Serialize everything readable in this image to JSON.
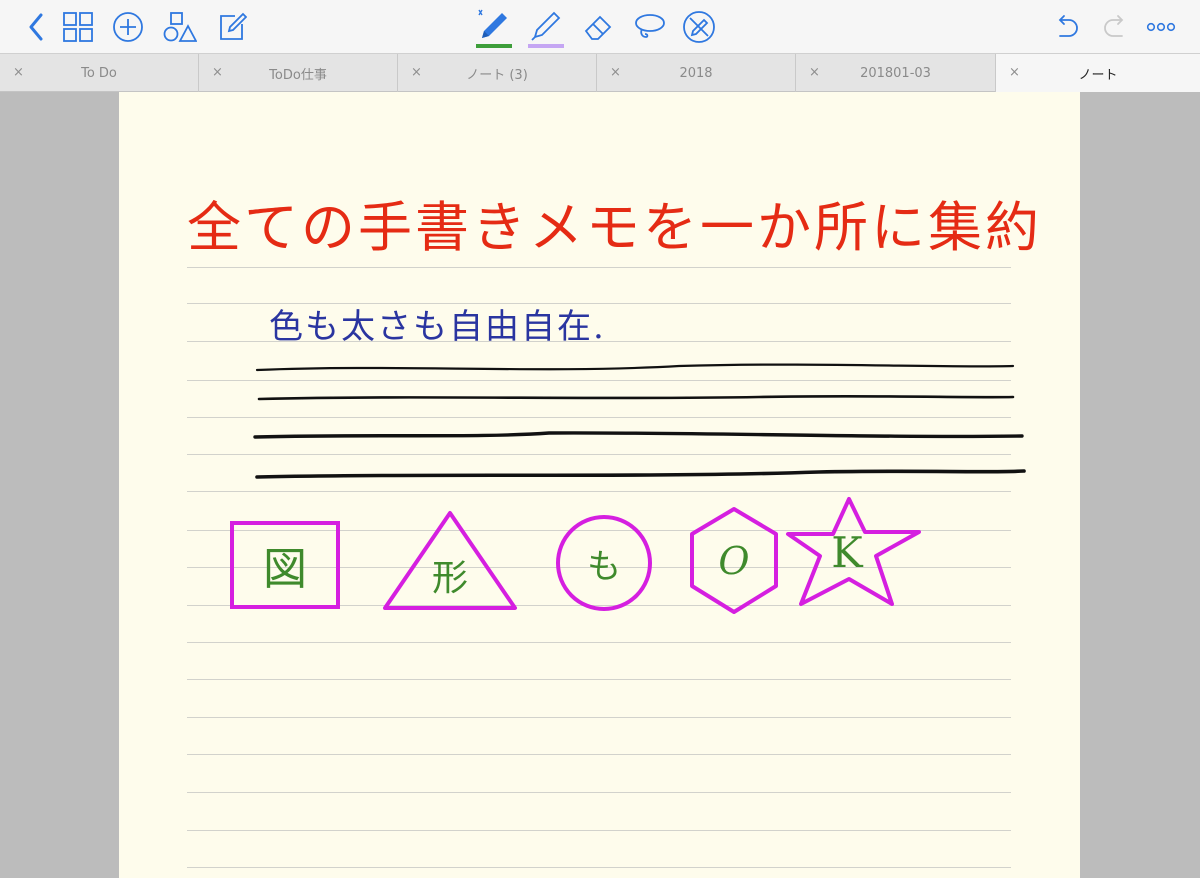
{
  "toolbar": {
    "left_icons": [
      "back-chevron-icon",
      "grid-icon",
      "add-circle-icon",
      "shapes-icon",
      "compose-icon"
    ],
    "center_tools": [
      "pen-tool-icon",
      "highlighter-icon",
      "eraser-icon",
      "lasso-icon",
      "disable-pen-icon"
    ],
    "right_icons": [
      "undo-icon",
      "redo-icon",
      "more-icon"
    ],
    "pen_color": "#3d9e3a",
    "highlighter_color": "#c5a6f3",
    "accent": "#2f78e0"
  },
  "tabs": [
    {
      "label": "To Do",
      "active": false
    },
    {
      "label": "ToDo仕事",
      "active": false
    },
    {
      "label": "ノート (3)",
      "active": false
    },
    {
      "label": "2018",
      "active": false
    },
    {
      "label": "201801-03",
      "active": false
    },
    {
      "label": "ノート",
      "active": true
    }
  ],
  "note": {
    "heading": "全ての手書きメモを一か所に集約",
    "subheading": "色も太さも自由自在.",
    "shapes": [
      {
        "shape": "square",
        "text": "図"
      },
      {
        "shape": "triangle",
        "text": "形"
      },
      {
        "shape": "circle",
        "text": "も"
      },
      {
        "shape": "hexagon",
        "text": "O"
      },
      {
        "shape": "star",
        "text": "K"
      }
    ],
    "colors": {
      "heading": "#e52b14",
      "subheading": "#2a35a0",
      "shape_outline": "#d51fe0",
      "shape_text": "#3f8a2c",
      "ink": "#111111",
      "paper": "#fefcec"
    }
  },
  "close_glyph": "×"
}
